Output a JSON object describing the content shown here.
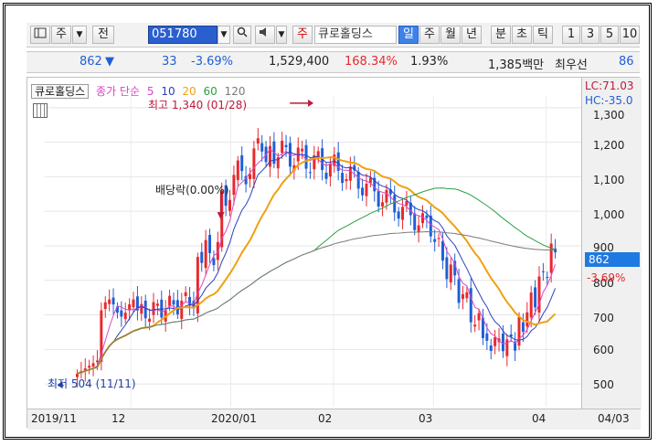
{
  "toolbar": {
    "layout_icon": "chart-layout-icon",
    "period_label": "주",
    "prev_label": "전",
    "stock_code": "051780",
    "search_icon": "search-icon",
    "sound_icon": "speaker-icon",
    "main_tag": "주",
    "stock_name": "큐로홀딩스",
    "periods": [
      "일",
      "주",
      "월",
      "년",
      "분",
      "초",
      "틱"
    ],
    "selected_period": "일",
    "counts": [
      "1",
      "3",
      "5",
      "10"
    ]
  },
  "infobar": {
    "price": "862",
    "arrow": "▼",
    "change": "33",
    "change_pct": "-3.69%",
    "volume": "1,529,400",
    "volume_ratio": "168.34%",
    "turnover": "1.93%",
    "amount": "1,385백만",
    "pref_label": "최우선",
    "pref_value": "86"
  },
  "legend": {
    "name": "큐로홀딩스",
    "ma_label": "종가 단순",
    "ma5": "5",
    "ma10": "10",
    "ma20": "20",
    "ma60": "60",
    "ma120": "120"
  },
  "annotations": {
    "high": "최고 1,340 (01/28)",
    "dividend": "배당락(0.00%)",
    "low": "최저 504 (11/11)"
  },
  "yaxis": {
    "lc": "LC:71.03",
    "hc": "HC:-35.0",
    "ticks": [
      "1,300",
      "1,200",
      "1,100",
      "1,000",
      "900",
      "800",
      "700",
      "600",
      "500"
    ],
    "current_price": "862",
    "current_pct": "-3.69%"
  },
  "xaxis": {
    "labels": [
      "2019/11",
      "12",
      "2020/01",
      "02",
      "03",
      "04",
      "04/03"
    ]
  },
  "colors": {
    "up": "#e8292e",
    "down": "#1f5fd6",
    "ma5": "#d946c9",
    "ma10": "#2b3fbf",
    "ma20": "#f0a010",
    "ma60": "#2aa040",
    "ma120": "#7a7a7a"
  }
}
